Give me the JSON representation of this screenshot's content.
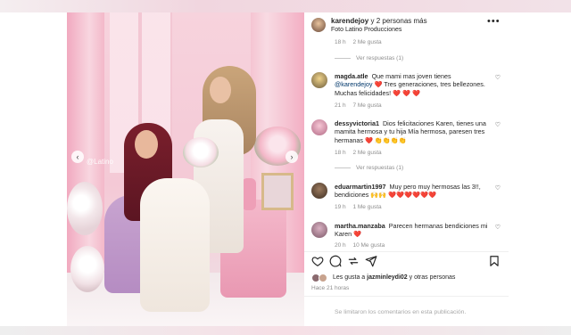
{
  "post": {
    "author": "karendejoy",
    "coauthors_text": "y 2 personas más",
    "subtitle": "Foto Latino Producciones",
    "more_icon": "more-horizontal-icon",
    "photo_watermark": "@Latino",
    "time_ago": "Hace 21 horas"
  },
  "comments": [
    {
      "type": "meta_only",
      "time": "18 h",
      "likes": "2 Me gusta"
    },
    {
      "type": "replies",
      "label": "Ver respuestas (1)"
    },
    {
      "user": "magda.atle",
      "text_before": "Que mami mas joven tienes",
      "mention": "@karendejoy",
      "text_after": "❤️ Tres generaciones, tres bellezones. Muchas felicidades! ❤️ ❤️ ❤️",
      "time": "21 h",
      "likes": "7 Me gusta"
    },
    {
      "user": "dessyvictoria1",
      "text": "Dios felicitaciones Karen, tienes una mamita hermosa y tu hija Mía hermosa, paresen tres hermanas ❤️ 👏👏👏👏",
      "time": "18 h",
      "likes": "2 Me gusta",
      "replies": "Ver respuestas (1)"
    },
    {
      "user": "eduarmartin1997",
      "text": "Muy pero muy hermosas las 3!!, bendiciones 🙌🙌 ❤️❤️❤️❤️❤️❤️",
      "time": "19 h",
      "likes": "1 Me gusta"
    },
    {
      "user": "martha.manzaba",
      "text": "Parecen hermanas bendiciones mi Karen ❤️",
      "time": "20 h",
      "likes": "10 Me gusta"
    }
  ],
  "actions": {
    "like_icon": "heart-icon",
    "comment_icon": "comment-icon",
    "share_icon": "share-icon",
    "save_icon": "bookmark-icon"
  },
  "likes_summary": {
    "prefix": "Les gusta a",
    "user": "jazminleydi02",
    "suffix": "y otras personas"
  },
  "comments_limited": "Se limitaron los comentarios en esta publicación.",
  "colors": {
    "text": "#262626",
    "muted": "#8e8e8e",
    "mention": "#00376b",
    "photo_pink": "#f4c9d6"
  }
}
